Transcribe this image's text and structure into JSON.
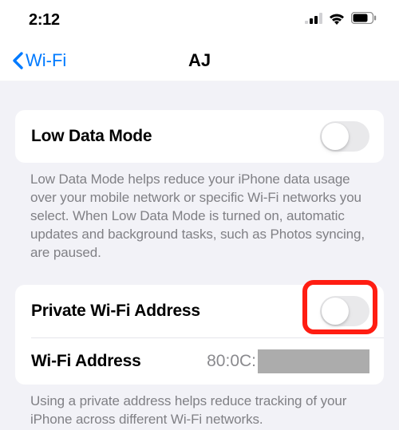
{
  "status": {
    "time": "2:12"
  },
  "nav": {
    "back_label": "Wi-Fi",
    "title": "AJ"
  },
  "section1": {
    "low_data_label": "Low Data Mode",
    "footer": "Low Data Mode helps reduce your iPhone data usage over your mobile network or specific Wi-Fi networks you select. When Low Data Mode is turned on, automatic updates and background tasks, such as Photos syncing, are paused."
  },
  "section2": {
    "private_label": "Private Wi-Fi Address",
    "wifi_address_label": "Wi-Fi Address",
    "wifi_address_value": "80:0C:",
    "footer": "Using a private address helps reduce tracking of your iPhone across different Wi-Fi networks."
  }
}
